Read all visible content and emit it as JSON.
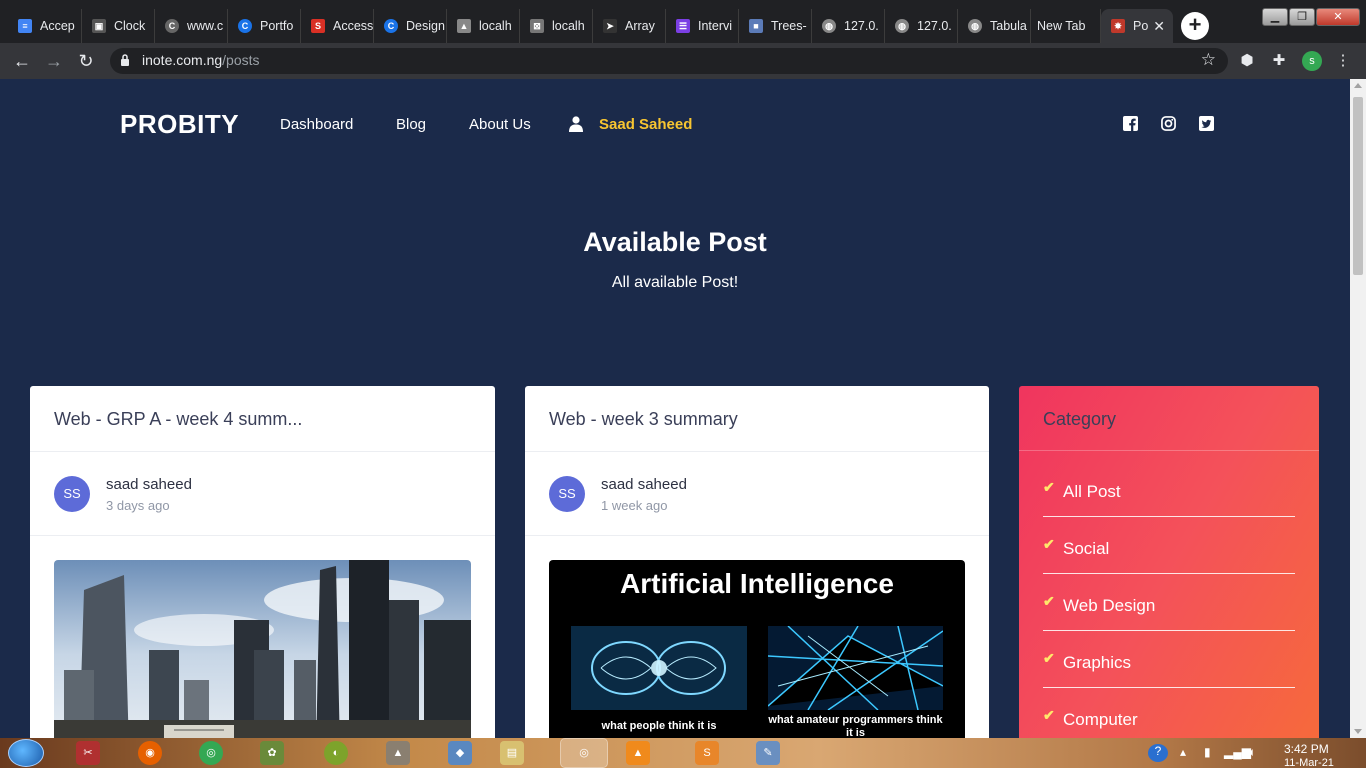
{
  "browser": {
    "tabs": [
      {
        "label": "Accep",
        "icon": "docs-icon",
        "color": "#4285f4"
      },
      {
        "label": "Clock",
        "icon": "clock-icon",
        "color": "#555555"
      },
      {
        "label": "www.c",
        "icon": "c-icon",
        "color": "#666666"
      },
      {
        "label": "Portfo",
        "icon": "c-icon",
        "color": "#1a73e8"
      },
      {
        "label": "Access",
        "icon": "access-icon",
        "color": "#d93025"
      },
      {
        "label": "Design",
        "icon": "c-icon",
        "color": "#1a73e8"
      },
      {
        "label": "localh",
        "icon": "mountain-icon",
        "color": "#888888"
      },
      {
        "label": "localh",
        "icon": "grid-icon",
        "color": "#777777"
      },
      {
        "label": "Array",
        "icon": "bird-icon",
        "color": "#333333"
      },
      {
        "label": "Intervi",
        "icon": "list-icon",
        "color": "#7b3fe4"
      },
      {
        "label": "Trees-",
        "icon": "square-icon",
        "color": "#5b7bb8"
      },
      {
        "label": "127.0.",
        "icon": "globe-icon",
        "color": "#888888"
      },
      {
        "label": "127.0.",
        "icon": "globe-icon",
        "color": "#888888"
      },
      {
        "label": "Tabula",
        "icon": "globe-icon",
        "color": "#888888"
      },
      {
        "label": "New Tab",
        "icon": "",
        "color": "#202124"
      },
      {
        "label": "Po",
        "icon": "spark-icon",
        "color": "#c0392b"
      }
    ],
    "url_host": "inote.com.ng",
    "url_path": "/posts",
    "profile_initial": "s"
  },
  "site": {
    "brand": "PROBITY",
    "nav": [
      {
        "label": "Dashboard"
      },
      {
        "label": "Blog"
      },
      {
        "label": "About Us"
      }
    ],
    "user_name": "Saad Saheed"
  },
  "hero": {
    "title": "Available Post",
    "subtitle": "All available Post!"
  },
  "posts": [
    {
      "title": "Web - GRP A - week 4 summ...",
      "initials": "SS",
      "author": "saad saheed",
      "time": "3 days ago",
      "image": "city-skyline"
    },
    {
      "title": "Web - week 3 summary",
      "initials": "SS",
      "author": "saad saheed",
      "time": "1 week ago",
      "image": "artificial-intelligence",
      "image_text": {
        "heading": "Artificial Intelligence",
        "left_caption": "what people think it is",
        "right_caption": "what amateur programmers think it is"
      }
    }
  ],
  "category": {
    "title": "Category",
    "items": [
      {
        "label": "All Post"
      },
      {
        "label": "Social"
      },
      {
        "label": "Web Design"
      },
      {
        "label": "Graphics"
      },
      {
        "label": "Computer"
      }
    ]
  },
  "taskbar": {
    "time": "3:42 PM",
    "date": "11-Mar-21"
  },
  "colors": {
    "page_bg": "#1b2a4a",
    "accent_yellow": "#f7c531",
    "avatar_bg": "#5d6bd8",
    "category_gradient_start": "#f0355e",
    "category_gradient_end": "#f66a3b"
  }
}
